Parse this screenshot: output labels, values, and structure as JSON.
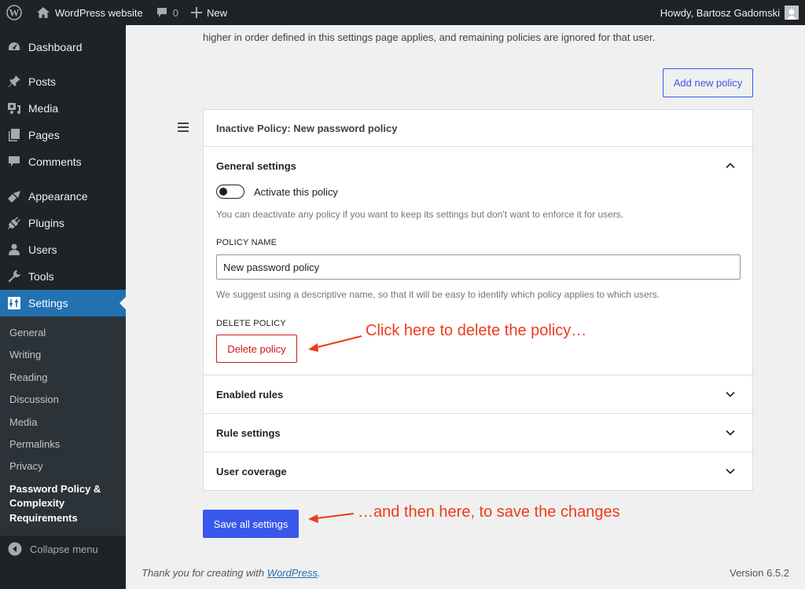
{
  "adminbar": {
    "wp_logo_icon": "wordpress-logo-icon",
    "site_name": "WordPress website",
    "comments_count": "0",
    "new_label": "New",
    "greeting": "Howdy, Bartosz Gadomski"
  },
  "sidebar": {
    "items": [
      {
        "label": "Dashboard",
        "icon": "dashboard-icon"
      },
      {
        "label": "Posts",
        "icon": "pin-icon"
      },
      {
        "label": "Media",
        "icon": "media-icon"
      },
      {
        "label": "Pages",
        "icon": "pages-icon"
      },
      {
        "label": "Comments",
        "icon": "comment-icon"
      },
      {
        "label": "Appearance",
        "icon": "brush-icon"
      },
      {
        "label": "Plugins",
        "icon": "plugin-icon"
      },
      {
        "label": "Users",
        "icon": "user-icon"
      },
      {
        "label": "Tools",
        "icon": "wrench-icon"
      },
      {
        "label": "Settings",
        "icon": "settings-sliders-icon",
        "active": true
      }
    ],
    "submenu": [
      "General",
      "Writing",
      "Reading",
      "Discussion",
      "Media",
      "Permalinks",
      "Privacy",
      "Password Policy & Complexity Requirements"
    ],
    "collapse_label": "Collapse menu"
  },
  "main": {
    "intro_text": "higher in order defined in this settings page applies, and remaining policies are ignored for that user.",
    "add_policy_label": "Add new policy",
    "policy_title": "Inactive Policy: New password policy",
    "sections": {
      "general": {
        "title": "General settings",
        "expanded": true,
        "toggle_label": "Activate this policy",
        "toggle_on": false,
        "toggle_help": "You can deactivate any policy if you want to keep its settings but don't want to enforce it for users.",
        "name_label": "POLICY NAME",
        "name_value": "New password policy",
        "name_help": "We suggest using a descriptive name, so that it will be easy to identify which policy applies to which users.",
        "delete_label": "DELETE POLICY",
        "delete_button": "Delete policy"
      },
      "enabled_rules": {
        "title": "Enabled rules",
        "expanded": false
      },
      "rule_settings": {
        "title": "Rule settings",
        "expanded": false
      },
      "user_coverage": {
        "title": "User coverage",
        "expanded": false
      }
    },
    "save_label": "Save all settings"
  },
  "annotations": {
    "first": "Click here to delete the policy…",
    "second": "…and then here, to save the changes",
    "color": "#ee3b1c"
  },
  "footer": {
    "thanks_prefix": "Thank you for creating with ",
    "thanks_link": "WordPress",
    "thanks_suffix": ".",
    "version": "Version 6.5.2"
  },
  "colors": {
    "admin_dark": "#1d2327",
    "active_blue": "#2271b1",
    "primary_button": "#3858e9",
    "danger": "#cc1818"
  }
}
